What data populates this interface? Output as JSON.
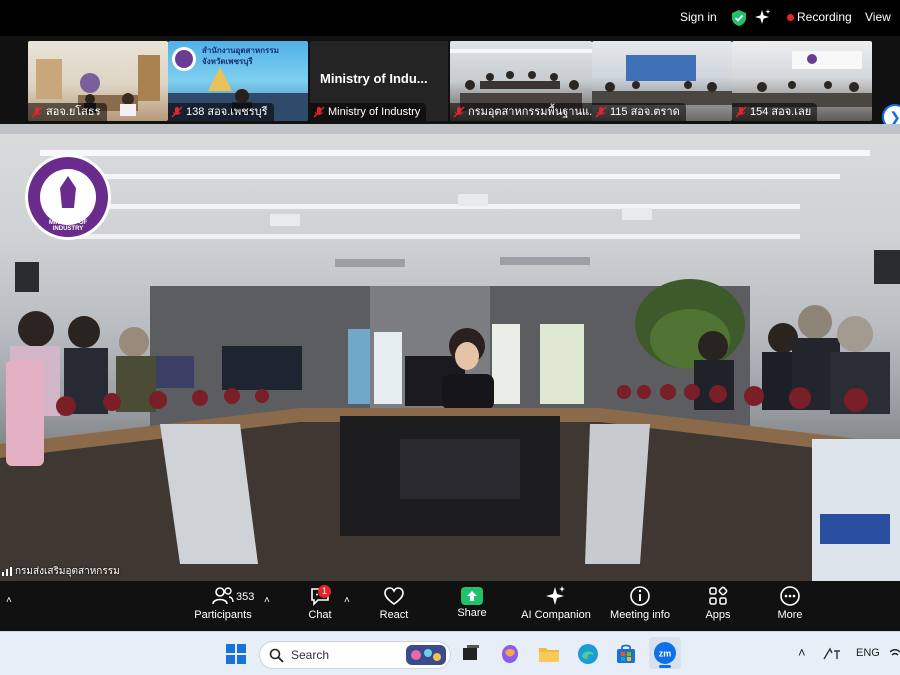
{
  "topbar": {
    "sign_in": "Sign in",
    "recording": "Recording",
    "view": "View"
  },
  "filmstrip": {
    "tiles": [
      {
        "caption": "สอจ.ยโสธร"
      },
      {
        "caption": "138 สอจ.เพชรบุรี",
        "sign_text": "สำนักงานอุตสาหกรรม จังหวัดเพชรบุรี"
      },
      {
        "caption": "Ministry of Industry",
        "title": "Ministry of Indu..."
      },
      {
        "caption": "กรมอุตสาหกรรมพื้นฐานแ..."
      },
      {
        "caption": "115 สอจ.ตราด"
      },
      {
        "caption": "154 สอจ.เลย"
      }
    ]
  },
  "main": {
    "speaker_name": "กรมส่งเสริมอุตสาหกรรม",
    "logo_text": "MINISTRY OF INDUSTRY"
  },
  "toolbar": {
    "participants_label": "Participants",
    "participants_count": "353",
    "chat_label": "Chat",
    "chat_badge": "1",
    "react_label": "React",
    "share_label": "Share",
    "ai_label": "AI Companion",
    "info_label": "Meeting info",
    "apps_label": "Apps",
    "more_label": "More"
  },
  "taskbar": {
    "search_placeholder": "Search",
    "lang": "ENG"
  },
  "colors": {
    "share_green": "#23c16b",
    "recording_red": "#e5242b",
    "accent_blue": "#0e71eb"
  }
}
